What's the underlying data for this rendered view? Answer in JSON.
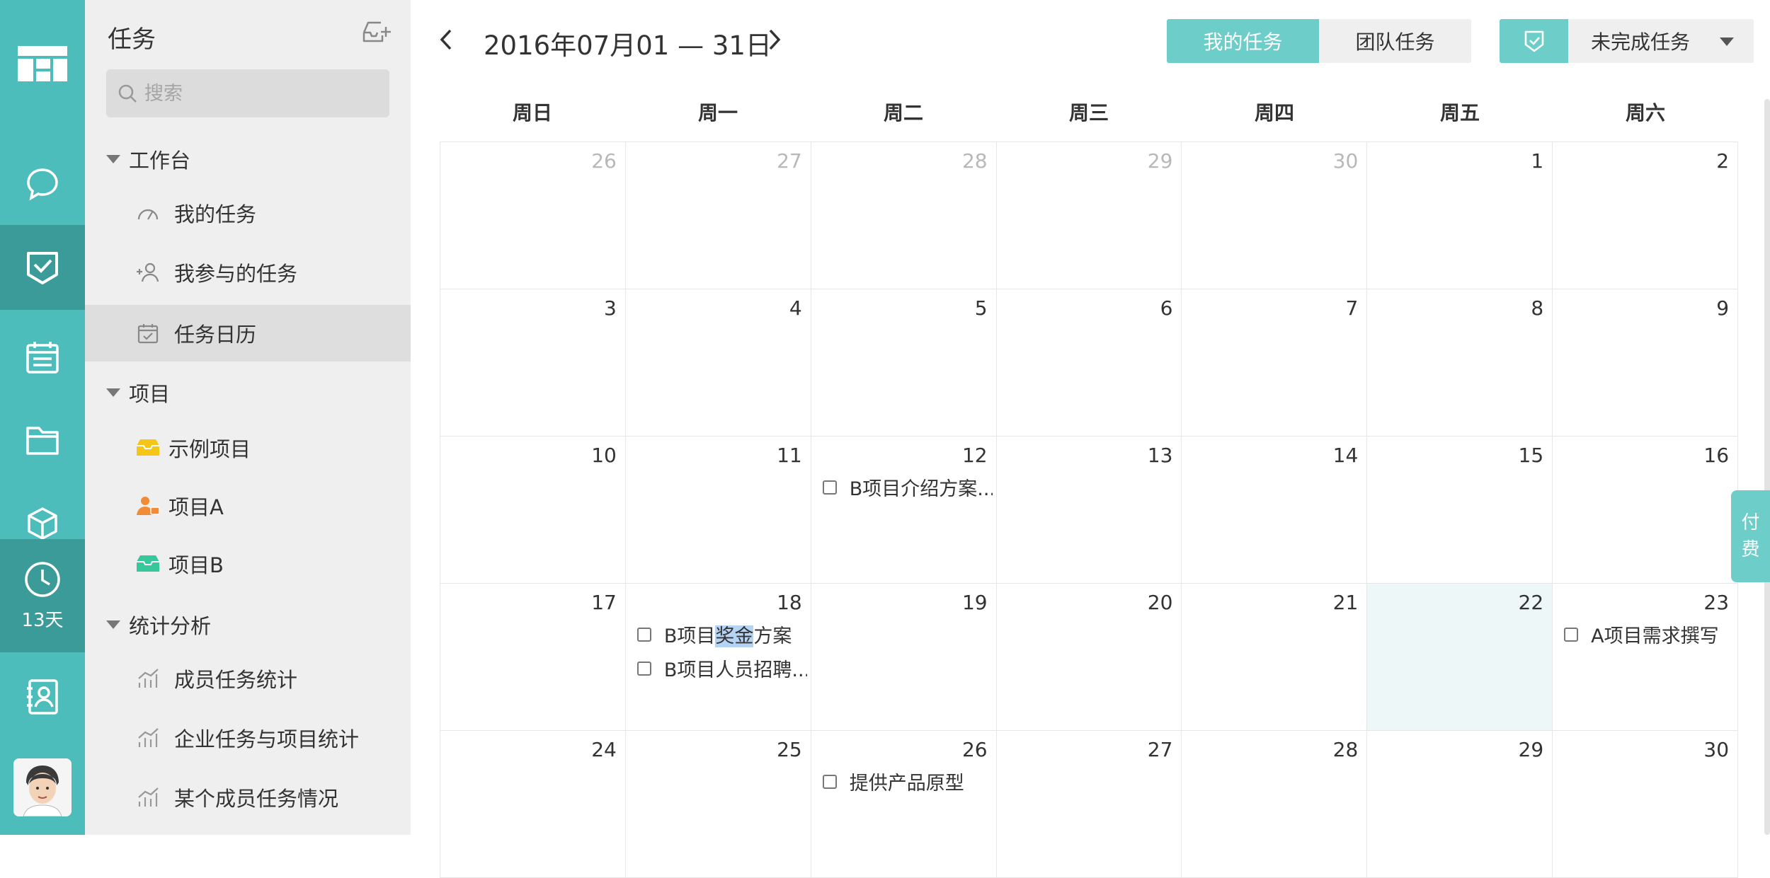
{
  "rail": {
    "timer_label": "13天"
  },
  "sidebar": {
    "title": "任务",
    "search_placeholder": "搜索",
    "groups": [
      {
        "label": "工作台",
        "items": [
          {
            "label": "我的任务"
          },
          {
            "label": "我参与的任务"
          },
          {
            "label": "任务日历"
          }
        ]
      },
      {
        "label": "项目",
        "items": [
          {
            "label": "示例项目"
          },
          {
            "label": "项目A"
          },
          {
            "label": "项目B"
          }
        ]
      },
      {
        "label": "统计分析",
        "items": [
          {
            "label": "成员任务统计"
          },
          {
            "label": "企业任务与项目统计"
          },
          {
            "label": "某个成员任务情况"
          }
        ]
      }
    ],
    "selected_item": "任务日历"
  },
  "header": {
    "date_range": "2016年07月01 — 31日",
    "tab_mine": "我的任务",
    "tab_team": "团队任务",
    "filter_value": "未完成任务"
  },
  "calendar": {
    "weekdays": [
      "周日",
      "周一",
      "周二",
      "周三",
      "周四",
      "周五",
      "周六"
    ],
    "weeks": [
      [
        "26",
        "27",
        "28",
        "29",
        "30",
        "1",
        "2"
      ],
      [
        "3",
        "4",
        "5",
        "6",
        "7",
        "8",
        "9"
      ],
      [
        "10",
        "11",
        "12",
        "13",
        "14",
        "15",
        "16"
      ],
      [
        "17",
        "18",
        "19",
        "20",
        "21",
        "22",
        "23"
      ],
      [
        "24",
        "25",
        "26",
        "27",
        "28",
        "29",
        "30"
      ]
    ],
    "tasks": {
      "w2d2": [
        "B项目介绍方案..."
      ],
      "w3d1_a_pre": "B项目",
      "w3d1_a_hl": "奖金",
      "w3d1_a_post": "方案",
      "w3d1_b": "B项目人员招聘...",
      "w3d6": [
        "A项目需求撰写"
      ],
      "w4d2": [
        "提供产品原型"
      ]
    }
  },
  "pay_tab": {
    "line1": "付",
    "line2": "费"
  },
  "colors": {
    "rail": "#4dbdbb",
    "rail_active": "#3a9b99",
    "accent": "#6dcdc8",
    "today": "#edf7f8"
  }
}
